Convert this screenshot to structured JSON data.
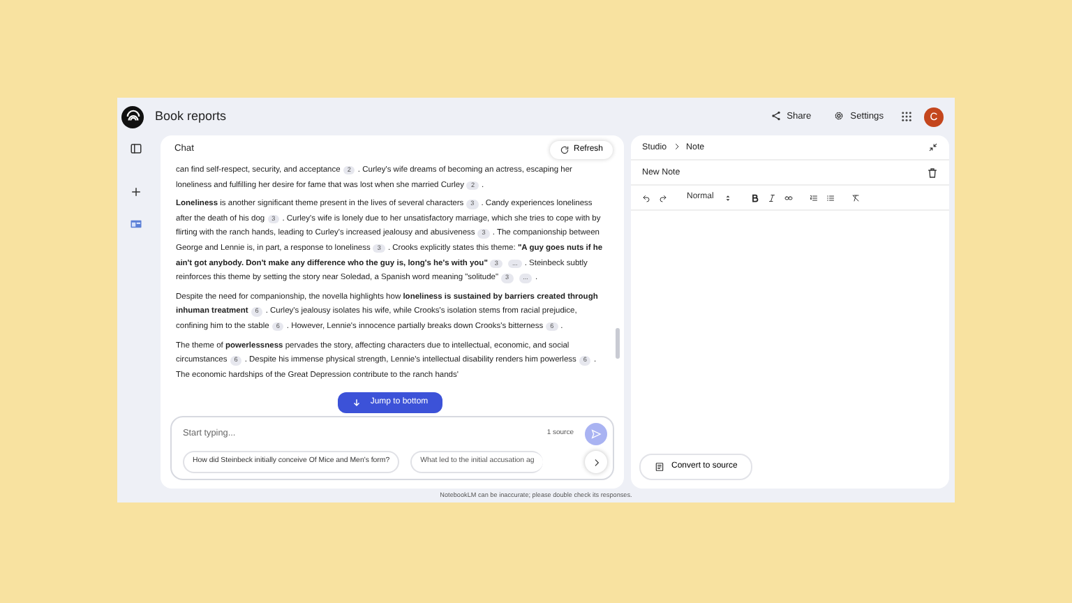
{
  "app": {
    "title": "Book reports",
    "share": "Share",
    "settings": "Settings",
    "avatar": "C"
  },
  "chat": {
    "title": "Chat",
    "refresh": "Refresh",
    "paragraphs": [
      [
        {
          "kind": "text",
          "text": "can find self-respect, security, and acceptance"
        },
        {
          "kind": "cite",
          "text": "2"
        },
        {
          "kind": "text",
          "text": ". Curley's wife dreams of becoming an actress, escaping her loneliness and fulfilling her desire for fame that was lost when she married Curley"
        },
        {
          "kind": "cite",
          "text": "2"
        },
        {
          "kind": "text",
          "text": "."
        }
      ],
      [
        {
          "kind": "text",
          "text": "**Loneliness** is another significant theme present in the lives of several characters"
        },
        {
          "kind": "cite",
          "text": "3"
        },
        {
          "kind": "text",
          "text": ". Candy experiences loneliness after the death of his dog"
        },
        {
          "kind": "cite",
          "text": "3"
        },
        {
          "kind": "text",
          "text": ". Curley's wife is lonely due to her unsatisfactory marriage, which she tries to cope with by flirting with the ranch hands, leading to Curley's increased jealousy and abusiveness"
        },
        {
          "kind": "cite",
          "text": "3"
        },
        {
          "kind": "text",
          "text": ". The companionship between George and Lennie is, in part, a response to loneliness"
        },
        {
          "kind": "cite",
          "text": "3"
        },
        {
          "kind": "text",
          "text": ". Crooks explicitly states this theme: **\"A guy goes nuts if he ain't got anybody. Don't make any difference who the guy is, long's he's with you\"**"
        },
        {
          "kind": "cite",
          "text": "3"
        },
        {
          "kind": "cite",
          "text": "..."
        },
        {
          "kind": "text",
          "text": ". Steinbeck subtly reinforces this theme by setting the story near Soledad, a Spanish word meaning \"solitude\""
        },
        {
          "kind": "cite",
          "text": "3"
        },
        {
          "kind": "cite",
          "text": "..."
        },
        {
          "kind": "text",
          "text": "."
        }
      ],
      [
        {
          "kind": "text",
          "text": "Despite the need for companionship, the novella highlights how **loneliness is sustained by barriers created through inhuman treatment**"
        },
        {
          "kind": "cite",
          "text": "6"
        },
        {
          "kind": "text",
          "text": ". Curley's jealousy isolates his wife, while Crooks's isolation stems from racial prejudice, confining him to the stable"
        },
        {
          "kind": "cite",
          "text": "6"
        },
        {
          "kind": "text",
          "text": ". However, Lennie's innocence partially breaks down Crooks's bitterness"
        },
        {
          "kind": "cite",
          "text": "6"
        },
        {
          "kind": "text",
          "text": "."
        }
      ],
      [
        {
          "kind": "text",
          "text": "The theme of **powerlessness** pervades the story, affecting characters due to intellectual, economic, and social circumstances"
        },
        {
          "kind": "cite",
          "text": "6"
        },
        {
          "kind": "text",
          "text": ". Despite his immense physical strength, Lennie's intellectual disability renders him powerless"
        },
        {
          "kind": "cite",
          "text": "6"
        },
        {
          "kind": "text",
          "text": ". The economic hardships of the Great Depression contribute to the ranch hands'"
        }
      ]
    ],
    "jump": "Jump to bottom",
    "composer": {
      "placeholder": "Start typing...",
      "sources": "1 source"
    },
    "suggestions": [
      "How did Steinbeck initially conceive Of Mice and Men's form?",
      "What led to the initial accusation ag"
    ]
  },
  "studio": {
    "crumbs": [
      "Studio",
      "Note"
    ],
    "note_title": "New Note",
    "style": "Normal",
    "convert": "Convert to source"
  },
  "footer": "NotebookLM can be inaccurate; please double check its responses."
}
